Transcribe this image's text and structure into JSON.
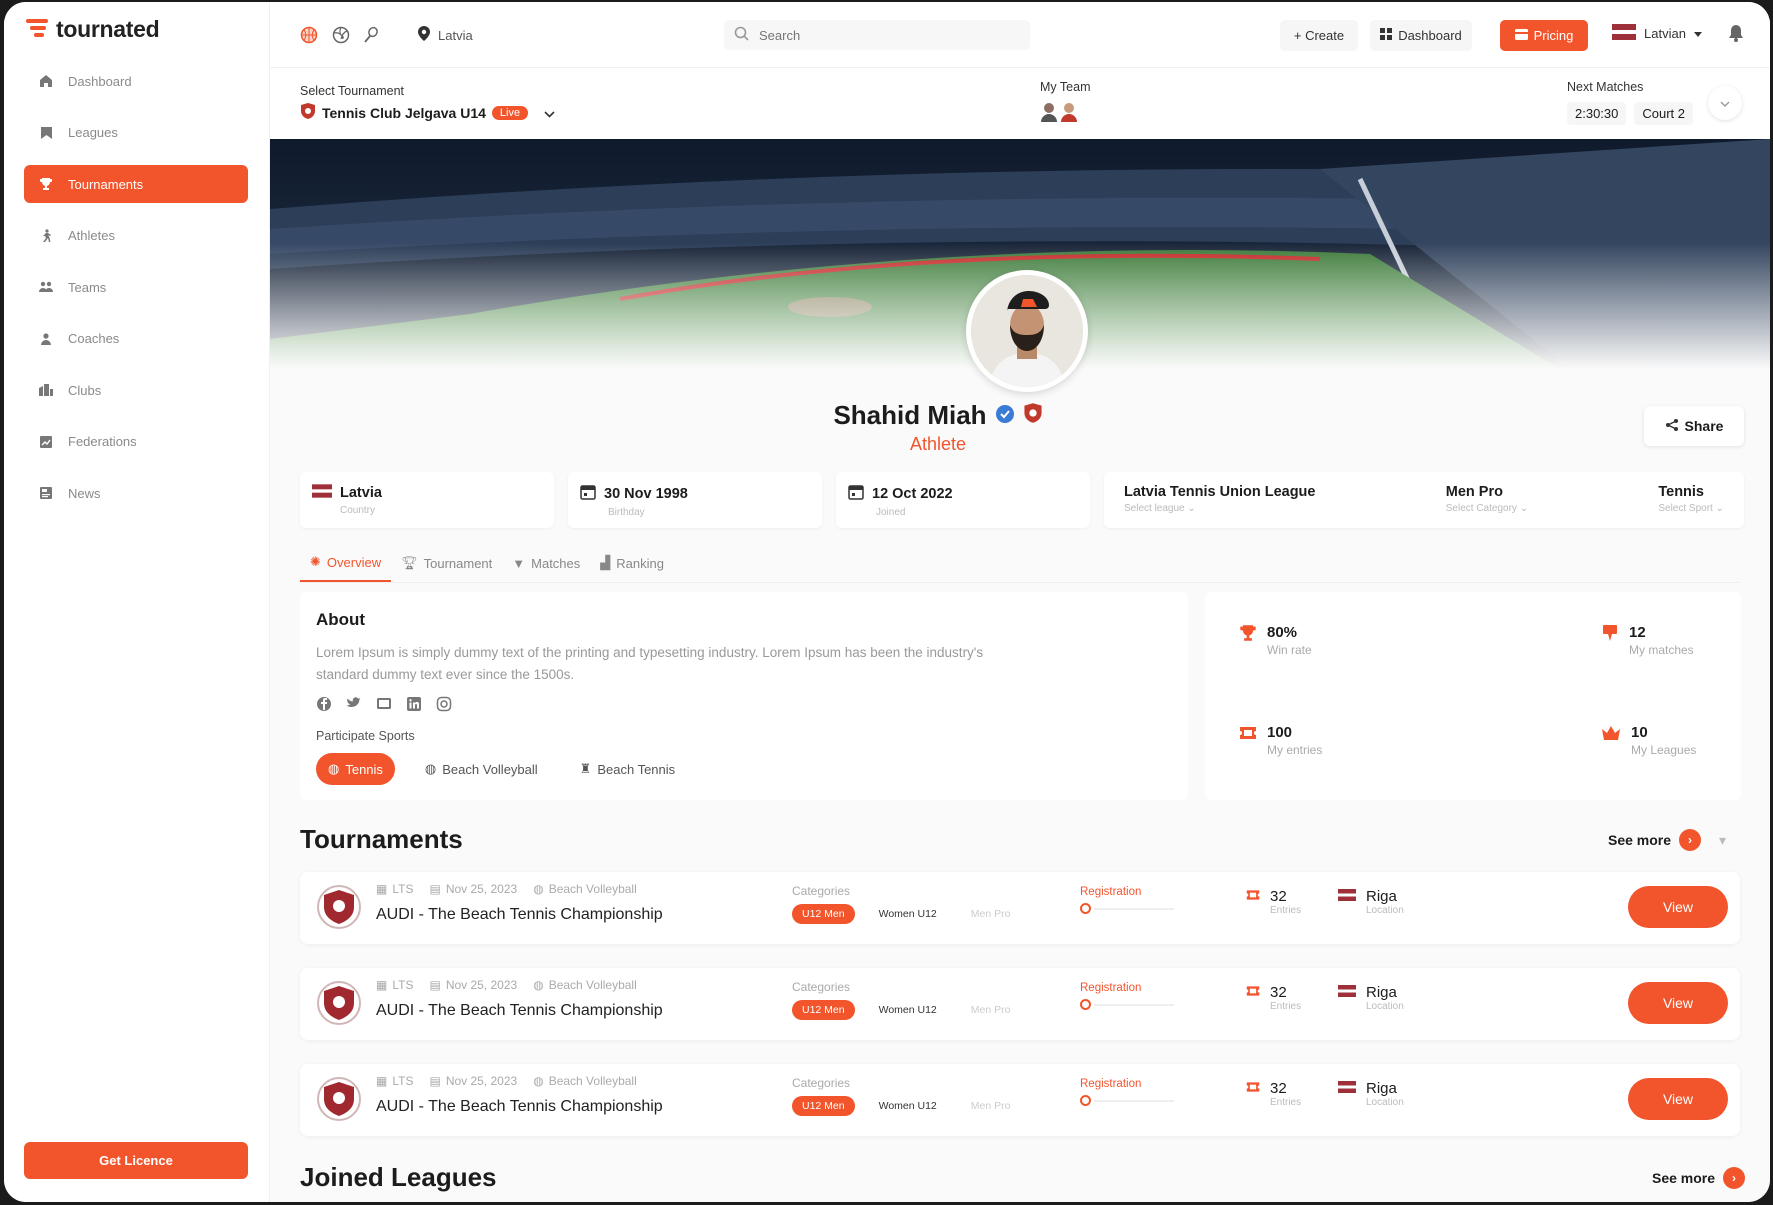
{
  "brand": {
    "name": "tournated",
    "accent": "#f2552c"
  },
  "sidebar": {
    "items": [
      {
        "label": "Dashboard",
        "icon": "home-icon"
      },
      {
        "label": "Leagues",
        "icon": "bookmark-icon"
      },
      {
        "label": "Tournaments",
        "icon": "trophy-icon",
        "active": true
      },
      {
        "label": "Athletes",
        "icon": "runner-icon"
      },
      {
        "label": "Teams",
        "icon": "team-icon"
      },
      {
        "label": "Coaches",
        "icon": "coach-icon"
      },
      {
        "label": "Clubs",
        "icon": "club-icon"
      },
      {
        "label": "Federations",
        "icon": "federation-icon"
      },
      {
        "label": "News",
        "icon": "news-icon"
      }
    ],
    "licence_label": "Get Licence"
  },
  "topbar": {
    "location": "Latvia",
    "search_placeholder": "Search",
    "create_label": "+ Create",
    "dashboard_label": "Dashboard",
    "pricing_label": "Pricing",
    "language": "Latvian"
  },
  "subbar": {
    "select_label": "Select Tournament",
    "tournament": "Tennis Club Jelgava U14",
    "live": "Live",
    "team_label": "My Team",
    "next_label": "Next Matches",
    "next_time": "2:30:30",
    "next_court": "Court 2"
  },
  "profile": {
    "name": "Shahid Miah",
    "role": "Athlete",
    "share_label": "Share"
  },
  "info": {
    "country": {
      "value": "Latvia",
      "label": "Country"
    },
    "birthday": {
      "value": "30 Nov 1998",
      "label": "Birthday"
    },
    "joined": {
      "value": "12 Oct 2022",
      "label": "Joined"
    },
    "league": {
      "value": "Latvia Tennis Union League",
      "label": "Select league"
    },
    "category": {
      "value": "Men Pro",
      "label": "Select Category"
    },
    "sport": {
      "value": "Tennis",
      "label": "Select Sport"
    }
  },
  "tabs": [
    "Overview",
    "Tournament",
    "Matches",
    "Ranking"
  ],
  "about": {
    "title": "About",
    "text": "Lorem Ipsum is simply dummy text of the printing and typesetting industry. Lorem Ipsum has been the industry's standard dummy text ever since the 1500s.",
    "participate_label": "Participate Sports",
    "sports": [
      "Tennis",
      "Beach Volleyball",
      "Beach Tennis"
    ]
  },
  "stats": [
    {
      "value": "80%",
      "label": "Win rate"
    },
    {
      "value": "12",
      "label": "My matches"
    },
    {
      "value": "100",
      "label": "My entries"
    },
    {
      "value": "10",
      "label": "My Leagues"
    }
  ],
  "tournaments": {
    "title": "Tournaments",
    "see_more": "See more",
    "rows": [
      {
        "org": "LTS",
        "date": "Nov 25, 2023",
        "sport": "Beach Volleyball",
        "name": "AUDI - The Beach Tennis Championship",
        "categories_label": "Categories",
        "cats": [
          "U12 Men",
          "Women U12",
          "Men Pro"
        ],
        "status": "Registration",
        "entries": "32",
        "entries_label": "Entries",
        "location": "Riga",
        "location_label": "Location",
        "view": "View"
      },
      {
        "org": "LTS",
        "date": "Nov 25, 2023",
        "sport": "Beach Volleyball",
        "name": "AUDI - The Beach Tennis Championship",
        "categories_label": "Categories",
        "cats": [
          "U12 Men",
          "Women U12",
          "Men Pro"
        ],
        "status": "Registration",
        "entries": "32",
        "entries_label": "Entries",
        "location": "Riga",
        "location_label": "Location",
        "view": "View"
      },
      {
        "org": "LTS",
        "date": "Nov 25, 2023",
        "sport": "Beach Volleyball",
        "name": "AUDI - The Beach Tennis Championship",
        "categories_label": "Categories",
        "cats": [
          "U12 Men",
          "Women U12",
          "Men Pro"
        ],
        "status": "Registration",
        "entries": "32",
        "entries_label": "Entries",
        "location": "Riga",
        "location_label": "Location",
        "view": "View"
      }
    ]
  },
  "leagues": {
    "title": "Joined Leagues",
    "see_more": "See more"
  }
}
